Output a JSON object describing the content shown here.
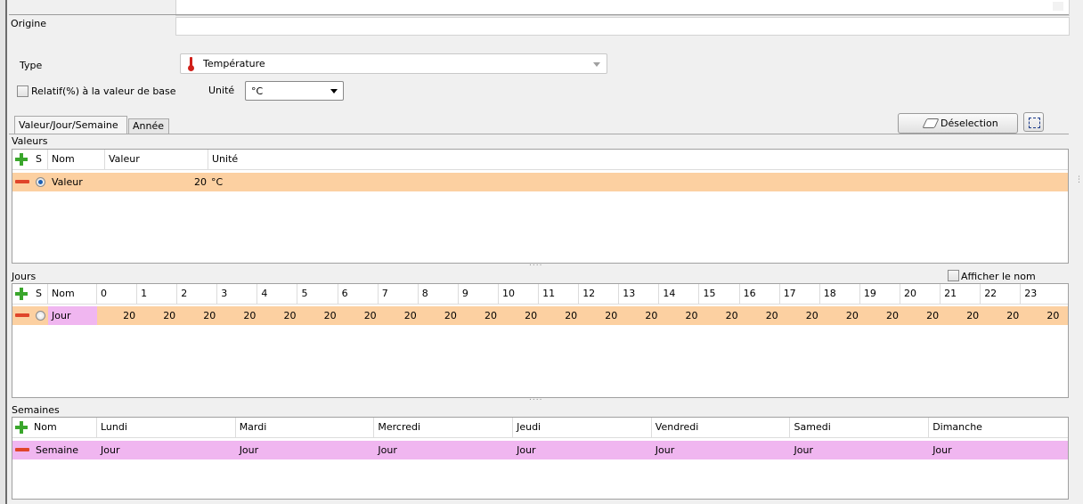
{
  "form": {
    "origin_label": "Origine",
    "type_label": "Type",
    "type_value": "Température",
    "relative_label": "Relatif(%) à la valeur de base",
    "unit_label": "Unité",
    "unit_value": "°C"
  },
  "tabs": [
    {
      "label": "Valeur/Jour/Semaine",
      "active": true
    },
    {
      "label": "Année",
      "active": false
    }
  ],
  "toolbar": {
    "deselect_label": "Déselection"
  },
  "values_section": {
    "title": "Valeurs",
    "columns": [
      "S",
      "Nom",
      "Valeur",
      "Unité"
    ],
    "rows": [
      {
        "name": "Valeur",
        "value": "20",
        "unit": "°C",
        "selected": true
      }
    ]
  },
  "days_section": {
    "title": "Jours",
    "show_name_label": "Afficher le nom",
    "columns": [
      "S",
      "Nom",
      "0",
      "1",
      "2",
      "3",
      "4",
      "5",
      "6",
      "7",
      "8",
      "9",
      "10",
      "11",
      "12",
      "13",
      "14",
      "15",
      "16",
      "17",
      "18",
      "19",
      "20",
      "21",
      "22",
      "23"
    ],
    "rows": [
      {
        "name": "Jour",
        "values": [
          "20",
          "20",
          "20",
          "20",
          "20",
          "20",
          "20",
          "20",
          "20",
          "20",
          "20",
          "20",
          "20",
          "20",
          "20",
          "20",
          "20",
          "20",
          "20",
          "20",
          "20",
          "20",
          "20",
          "20"
        ]
      }
    ]
  },
  "weeks_section": {
    "title": "Semaines",
    "columns": [
      "Nom",
      "Lundi",
      "Mardi",
      "Mercredi",
      "Jeudi",
      "Vendredi",
      "Samedi",
      "Dimanche"
    ],
    "rows": [
      {
        "name": "Semaine",
        "days": [
          "Jour",
          "Jour",
          "Jour",
          "Jour",
          "Jour",
          "Jour",
          "Jour"
        ]
      }
    ]
  },
  "colors": {
    "row_orange": "#fcd0a1",
    "row_pink": "#f0b6f0",
    "accent_plus": "#3aa62c",
    "accent_minus": "#e0452a",
    "thermometer": "#d0201a"
  }
}
